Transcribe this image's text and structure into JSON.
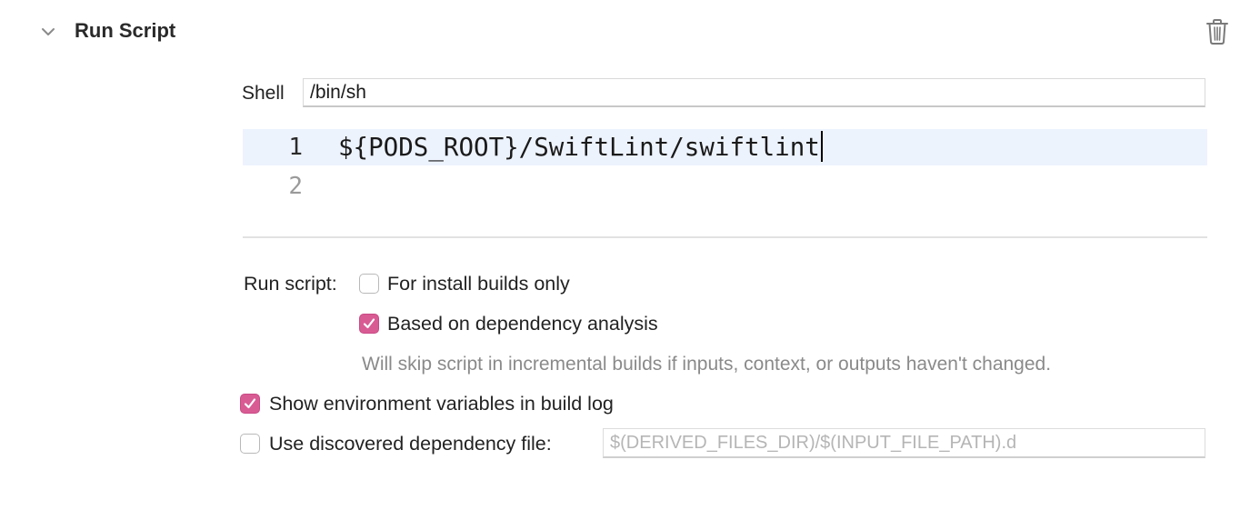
{
  "header": {
    "title": "Run Script",
    "collapse_icon": "chevron-down-icon",
    "delete_icon": "trash-icon"
  },
  "shell": {
    "label": "Shell",
    "value": "/bin/sh"
  },
  "editor": {
    "lines": [
      {
        "number": "1",
        "text": "${PODS_ROOT}/SwiftLint/swiftlint"
      },
      {
        "number": "2",
        "text": ""
      }
    ]
  },
  "options": {
    "run_script_label": "Run script:",
    "install_builds_only": {
      "label": "For install builds only",
      "checked": false
    },
    "dependency_analysis": {
      "label": "Based on dependency analysis",
      "checked": true
    },
    "dependency_hint": "Will skip script in incremental builds if inputs, context, or outputs haven't changed.",
    "show_env_vars": {
      "label": "Show environment variables in build log",
      "checked": true
    },
    "discovered_dependency_file": {
      "label": "Use discovered dependency file:",
      "checked": false,
      "placeholder": "$(DERIVED_FILES_DIR)/$(INPUT_FILE_PATH).d",
      "value": ""
    }
  },
  "colors": {
    "accent": "#d95b94",
    "active_line": "#edf3fd",
    "hint_text": "#8a8a8a"
  }
}
